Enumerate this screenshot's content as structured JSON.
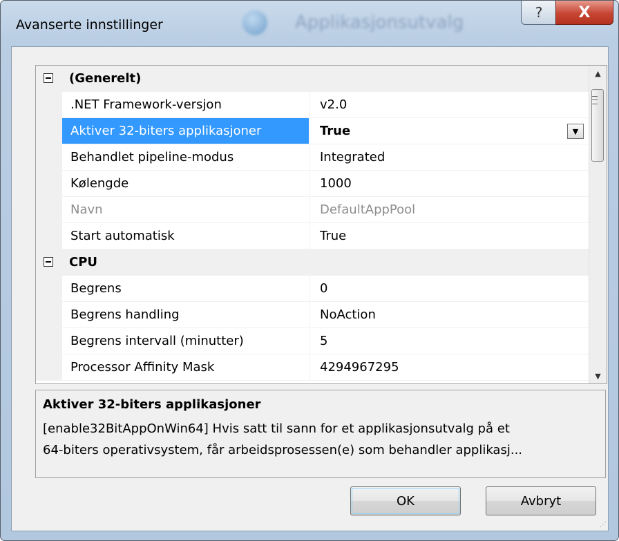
{
  "window": {
    "title": "Avanserte innstillinger",
    "background_caption": "Applikasjonsutvalg",
    "help_glyph": "?",
    "close_glyph": "X"
  },
  "grid": {
    "rows": [
      {
        "type": "category",
        "name": "(Generelt)"
      },
      {
        "type": "property",
        "name": ".NET Framework-versjon",
        "value": "v2.0"
      },
      {
        "type": "property",
        "name": "Aktiver 32-biters applikasjoner",
        "value": "True",
        "selected": true
      },
      {
        "type": "property",
        "name": "Behandlet pipeline-modus",
        "value": "Integrated"
      },
      {
        "type": "property",
        "name": "Kølengde",
        "value": "1000"
      },
      {
        "type": "property",
        "name": "Navn",
        "value": "DefaultAppPool",
        "disabled": true
      },
      {
        "type": "property",
        "name": "Start automatisk",
        "value": "True"
      },
      {
        "type": "category",
        "name": "CPU"
      },
      {
        "type": "property",
        "name": "Begrens",
        "value": "0"
      },
      {
        "type": "property",
        "name": "Begrens handling",
        "value": "NoAction"
      },
      {
        "type": "property",
        "name": "Begrens intervall (minutter)",
        "value": "5"
      },
      {
        "type": "property",
        "name": "Processor Affinity Mask",
        "value": "4294967295"
      }
    ]
  },
  "description": {
    "title": "Aktiver 32-biters applikasjoner",
    "line1": "[enable32BitAppOnWin64] Hvis satt til sann for et applikasjonsutvalg på et",
    "line2": "64-biters operativsystem, får arbeidsprosessen(e) som behandler applikasj..."
  },
  "buttons": {
    "ok": "OK",
    "cancel": "Avbryt"
  },
  "colors": {
    "selection": "#3399ff",
    "close_button": "#c64533"
  }
}
